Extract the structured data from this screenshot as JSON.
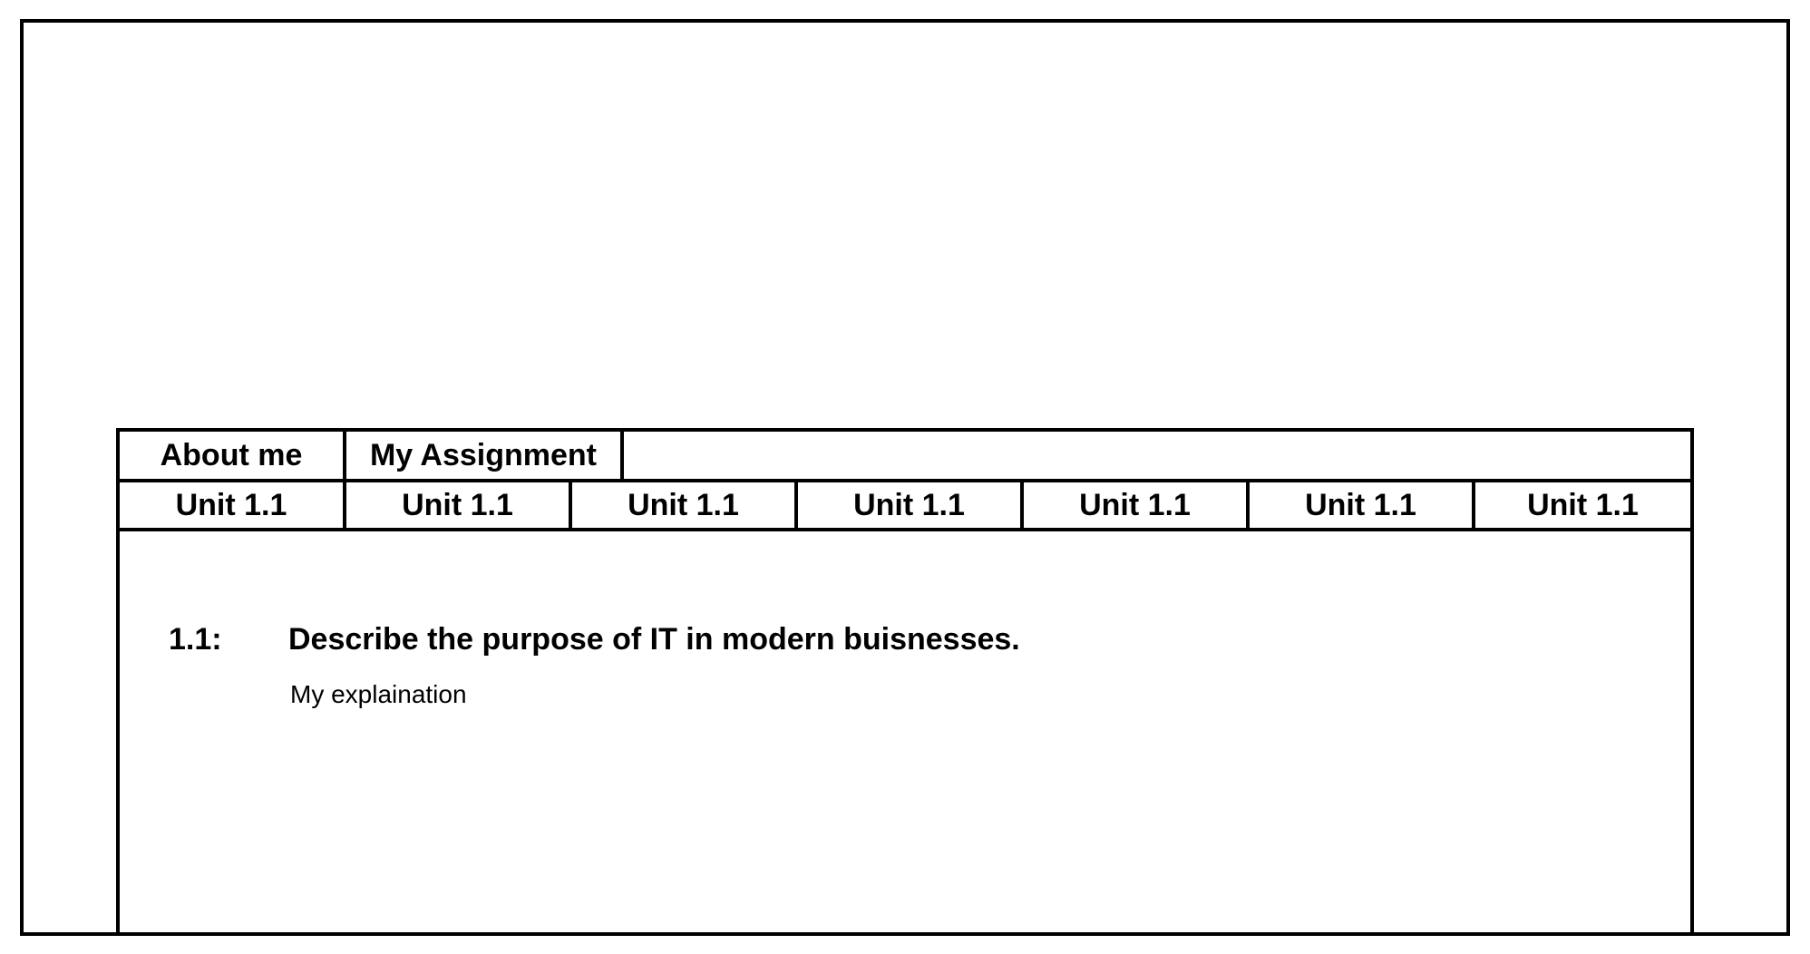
{
  "nav": {
    "top_tabs": [
      {
        "label": "About me"
      },
      {
        "label": "My Assignment"
      }
    ],
    "unit_tabs": [
      {
        "label": "Unit 1.1"
      },
      {
        "label": "Unit 1.1"
      },
      {
        "label": "Unit 1.1"
      },
      {
        "label": "Unit 1.1"
      },
      {
        "label": "Unit 1.1"
      },
      {
        "label": "Unit 1.1"
      },
      {
        "label": "Unit 1.1"
      }
    ]
  },
  "content": {
    "question_number": "1.1:",
    "question_text": "Describe the purpose of IT in modern buisnesses.",
    "answer_text": "My explaination"
  },
  "colors": {
    "border": "#000000",
    "background": "#ffffff",
    "text": "#000000"
  }
}
